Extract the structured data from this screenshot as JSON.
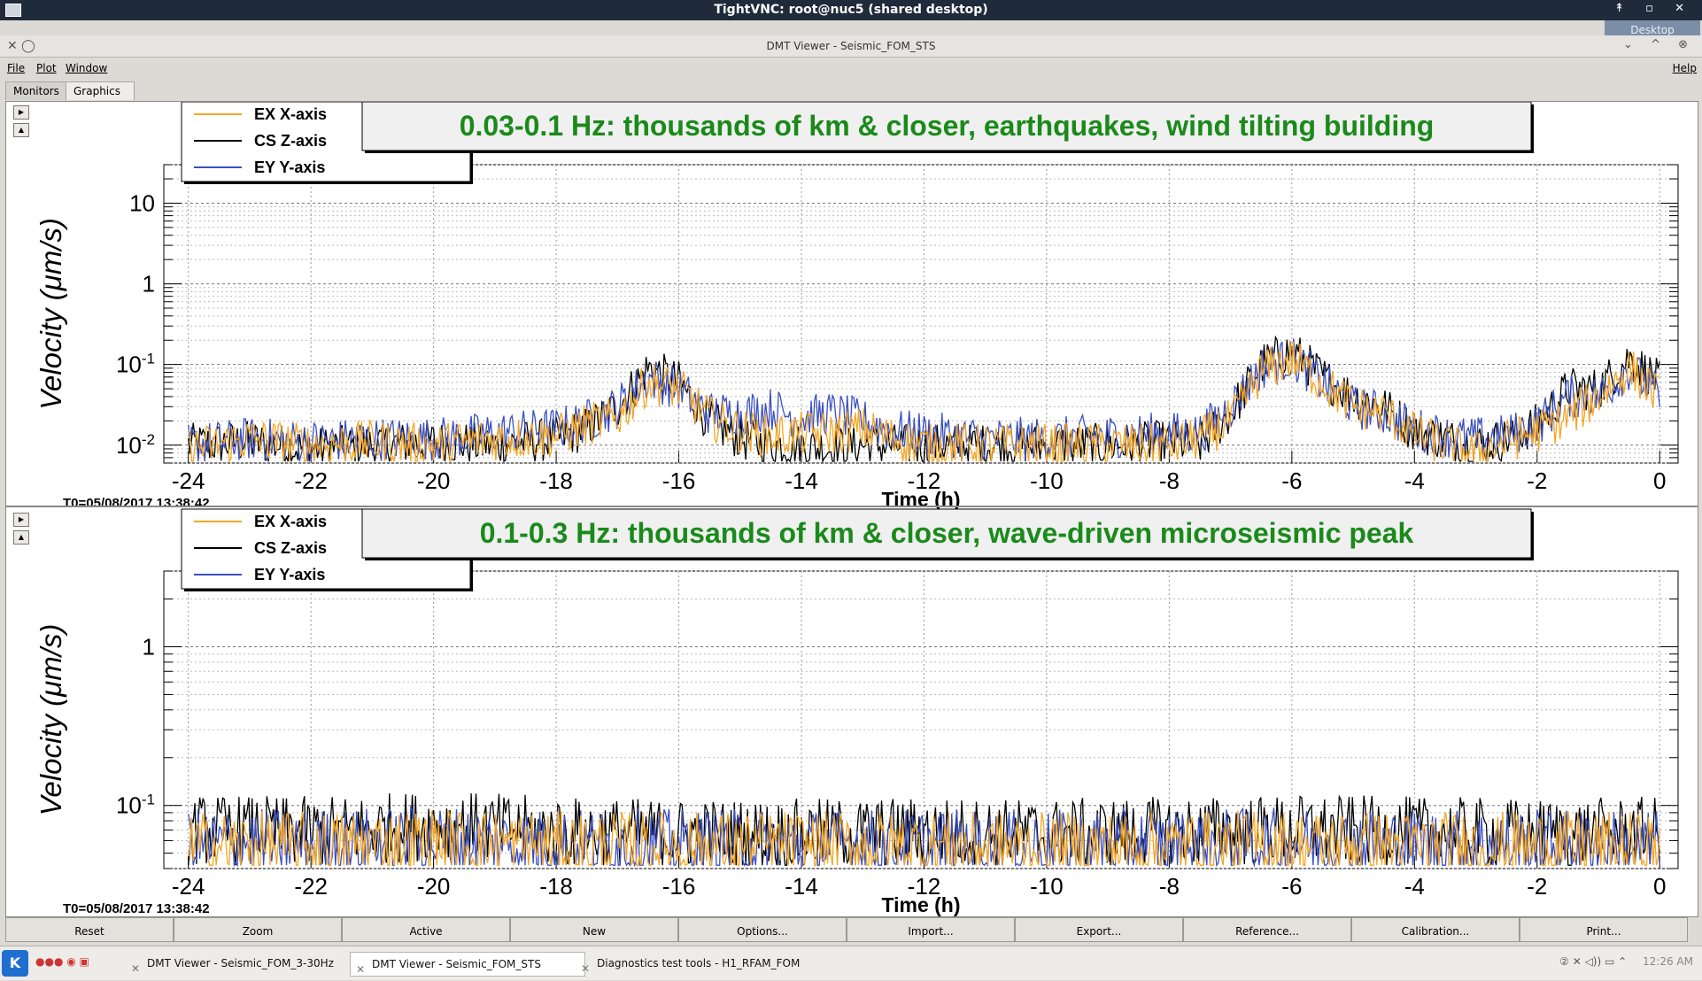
{
  "vnc": {
    "title": "TightVNC: root@nuc5 (shared desktop)",
    "desktop_tab": "Desktop",
    "controls": "↟ ▫ ✕"
  },
  "window": {
    "title": "DMT Viewer - Seismic_FOM_STS",
    "left_icons": "✕ ◯",
    "right_icons": "⌄ ^ ⊗"
  },
  "menu": {
    "file": "File",
    "plot": "Plot",
    "window": "Window",
    "help": "Help"
  },
  "tabs": {
    "monitors": "Monitors",
    "graphics": "Graphics"
  },
  "colors": {
    "ex": "#f5a623",
    "cs": "#000000",
    "ey": "#3a4fc0",
    "title_text": "#1a8a1a"
  },
  "legend": [
    {
      "name": "EX X-axis",
      "color": "#f5a623"
    },
    {
      "name": "CS Z-axis",
      "color": "#000000"
    },
    {
      "name": "EY Y-axis",
      "color": "#3a4fc0"
    }
  ],
  "plots": [
    {
      "title": "0.03-0.1 Hz: thousands of km & closer, earthquakes, wind tilting building",
      "ylabel": "Velocity  (μm/s)",
      "xlabel": "Time (h)",
      "t0": "T0=05/08/2017 13:38:42",
      "ytick_labels": [
        "10",
        "1",
        "10-1",
        "10-2"
      ]
    },
    {
      "title": "0.1-0.3 Hz: thousands of km & closer, wave-driven microseismic peak",
      "ylabel": "Velocity  (μm/s)",
      "xlabel": "Time (h)",
      "t0": "T0=05/08/2017 13:38:42",
      "ytick_labels": [
        "1",
        "10-1"
      ]
    }
  ],
  "xtick_labels": [
    "-24",
    "-22",
    "-20",
    "-18",
    "-16",
    "-14",
    "-12",
    "-10",
    "-8",
    "-6",
    "-4",
    "-2",
    "0"
  ],
  "chart_data": [
    {
      "type": "line",
      "title": "0.03-0.1 Hz: thousands of km & closer, earthquakes, wind tilting building",
      "xlabel": "Time (h)",
      "ylabel": "Velocity  (μm/s)",
      "xlim": [
        -24.4,
        0.3
      ],
      "ylim": [
        0.006,
        30
      ],
      "log_y": true,
      "grid": true,
      "legend_position": "top-left",
      "x": [
        -24,
        -23,
        -22,
        -21,
        -20,
        -19,
        -18,
        -17.5,
        -17,
        -16.5,
        -16,
        -15.5,
        -15,
        -14.5,
        -14,
        -13.5,
        -13,
        -12.5,
        -12,
        -11,
        -10,
        -9,
        -8,
        -7.5,
        -7,
        -6.5,
        -6,
        -5.5,
        -5,
        -4.5,
        -4,
        -3.5,
        -3,
        -2.5,
        -2,
        -1.5,
        -1,
        -0.5,
        0
      ],
      "series": [
        {
          "name": "EX X-axis",
          "values": [
            0.009,
            0.012,
            0.01,
            0.011,
            0.01,
            0.012,
            0.013,
            0.018,
            0.022,
            0.06,
            0.05,
            0.022,
            0.015,
            0.013,
            0.014,
            0.014,
            0.016,
            0.012,
            0.01,
            0.01,
            0.01,
            0.01,
            0.01,
            0.012,
            0.02,
            0.08,
            0.12,
            0.06,
            0.03,
            0.025,
            0.014,
            0.01,
            0.008,
            0.011,
            0.015,
            0.022,
            0.04,
            0.09,
            0.04
          ]
        },
        {
          "name": "CS Z-axis",
          "values": [
            0.01,
            0.011,
            0.009,
            0.01,
            0.011,
            0.01,
            0.012,
            0.016,
            0.03,
            0.09,
            0.06,
            0.02,
            0.012,
            0.01,
            0.01,
            0.009,
            0.01,
            0.01,
            0.01,
            0.01,
            0.01,
            0.01,
            0.011,
            0.01,
            0.025,
            0.1,
            0.15,
            0.07,
            0.04,
            0.03,
            0.015,
            0.012,
            0.01,
            0.012,
            0.018,
            0.05,
            0.05,
            0.12,
            0.06
          ]
        },
        {
          "name": "EY Y-axis",
          "values": [
            0.01,
            0.012,
            0.011,
            0.012,
            0.012,
            0.014,
            0.016,
            0.02,
            0.03,
            0.07,
            0.05,
            0.025,
            0.025,
            0.028,
            0.022,
            0.025,
            0.02,
            0.015,
            0.014,
            0.012,
            0.012,
            0.013,
            0.014,
            0.014,
            0.03,
            0.09,
            0.12,
            0.06,
            0.03,
            0.025,
            0.016,
            0.013,
            0.012,
            0.013,
            0.018,
            0.04,
            0.04,
            0.09,
            0.04
          ]
        }
      ]
    },
    {
      "type": "line",
      "title": "0.1-0.3 Hz: thousands of km & closer, wave-driven microseismic peak",
      "xlabel": "Time (h)",
      "ylabel": "Velocity  (μm/s)",
      "xlim": [
        -24.4,
        0.3
      ],
      "ylim": [
        0.04,
        3
      ],
      "log_y": true,
      "grid": true,
      "legend_position": "top-left",
      "x": [
        -24,
        -22,
        -20,
        -18,
        -16,
        -14,
        -12,
        -10,
        -8,
        -6,
        -4,
        -2,
        0
      ],
      "series": [
        {
          "name": "EX X-axis",
          "values": [
            0.055,
            0.055,
            0.058,
            0.055,
            0.055,
            0.055,
            0.055,
            0.054,
            0.055,
            0.056,
            0.055,
            0.055,
            0.054
          ]
        },
        {
          "name": "CS Z-axis",
          "values": [
            0.07,
            0.068,
            0.075,
            0.068,
            0.066,
            0.066,
            0.068,
            0.066,
            0.068,
            0.07,
            0.068,
            0.066,
            0.068
          ]
        },
        {
          "name": "EY Y-axis",
          "values": [
            0.058,
            0.057,
            0.06,
            0.057,
            0.057,
            0.057,
            0.057,
            0.056,
            0.057,
            0.058,
            0.057,
            0.057,
            0.056
          ]
        }
      ]
    }
  ],
  "buttons": [
    "Reset",
    "Zoom",
    "Active",
    "New",
    "Options...",
    "Import...",
    "Export...",
    "Reference...",
    "Calibration...",
    "Print..."
  ],
  "taskbar": {
    "start": "K",
    "quick": "●●● ◉ ▣",
    "tasks": [
      "DMT Viewer - Seismic_FOM_3-30Hz",
      "DMT Viewer - Seismic_FOM_STS",
      "Diagnostics test tools - H1_RFAM_FOM"
    ],
    "tray": "② ✕ ◁)) ▭ ⌃",
    "clock": "12:26 AM"
  }
}
